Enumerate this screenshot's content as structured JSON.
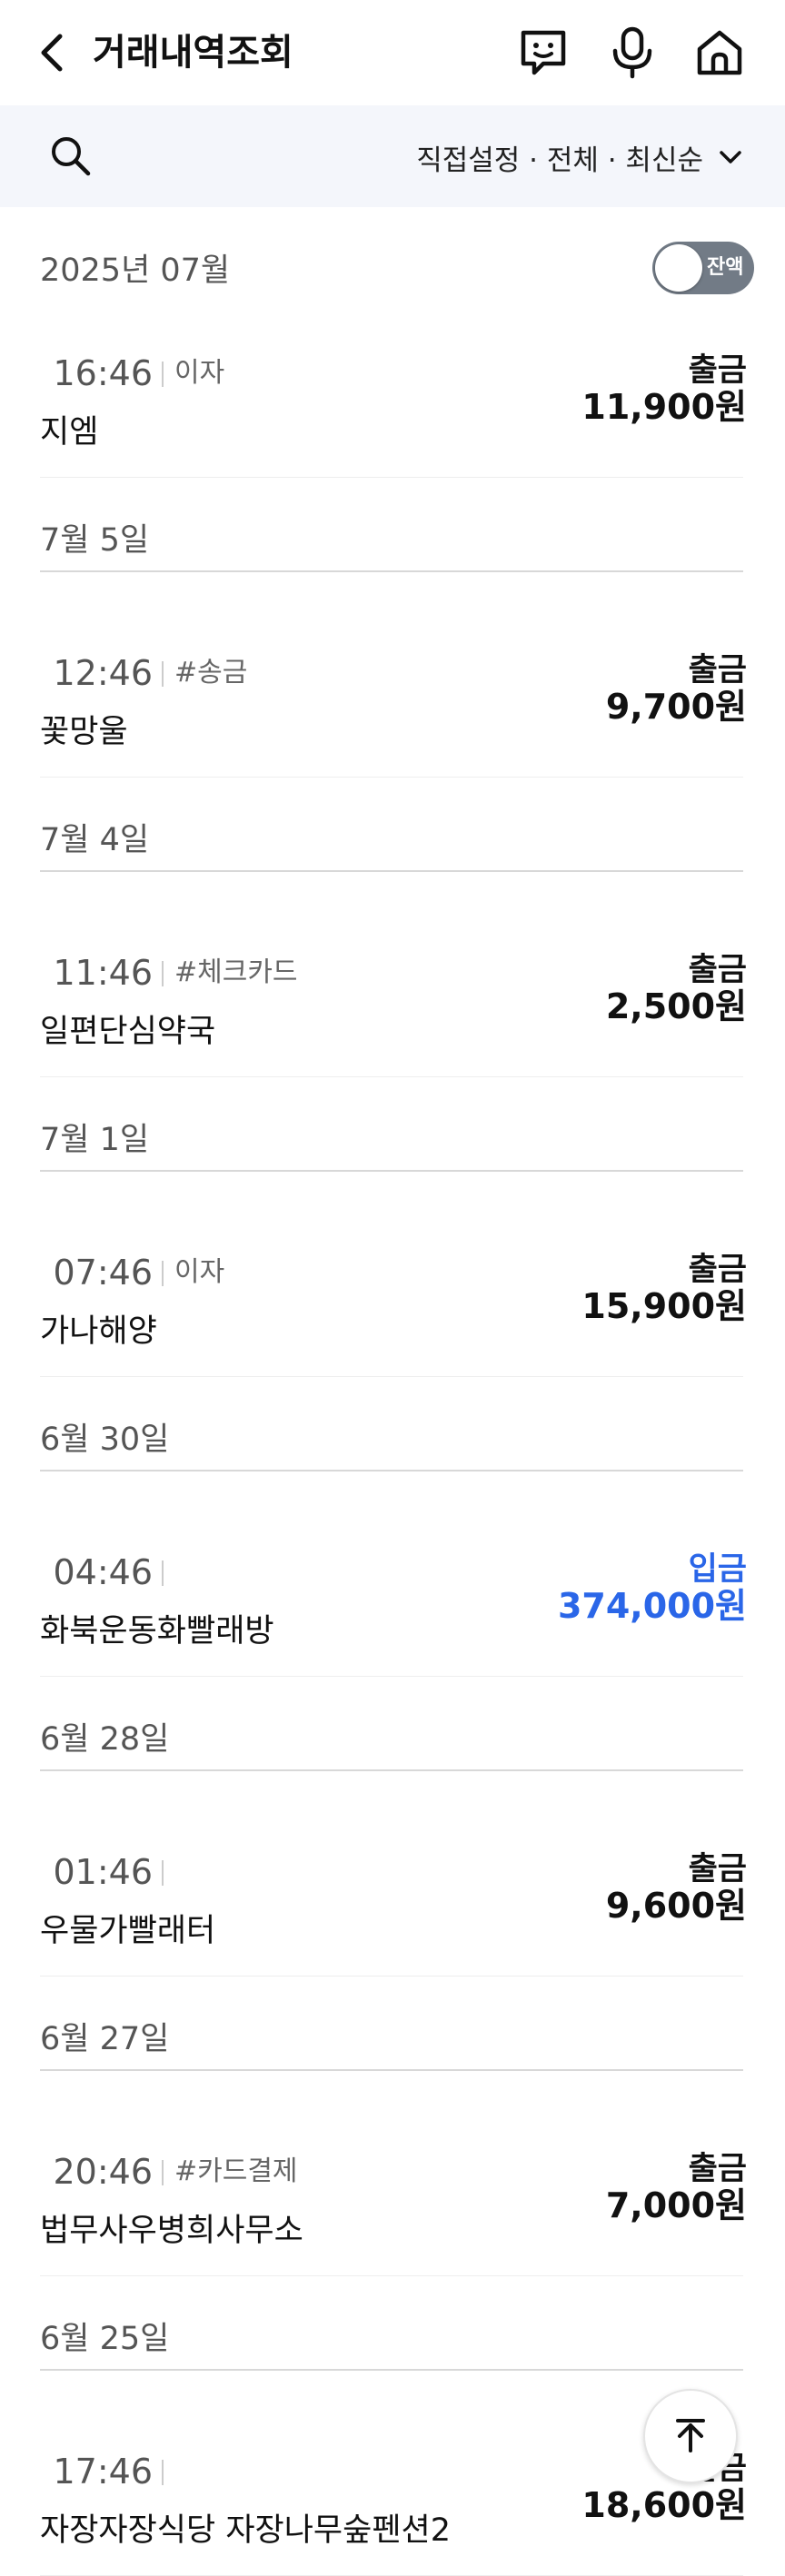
{
  "header": {
    "title": "거래내역조회",
    "back_icon": "chevron-left-icon",
    "icons": [
      "chat-icon",
      "mic-icon",
      "home-icon"
    ]
  },
  "filter": {
    "search_icon": "search-icon",
    "summary": "직접설정 · 전체 · 최신순",
    "dropdown_icon": "chevron-down-icon"
  },
  "month": {
    "label": "2025년 07월",
    "balance_toggle_label": "잔액",
    "balance_toggle_on": false
  },
  "colors": {
    "deposit": "#2a66e8",
    "withdrawal": "#111111",
    "filter_bg": "#f4f6fb",
    "toggle_bg": "#727b86"
  },
  "groups": [
    {
      "date": "",
      "items": [
        {
          "time": "16:46",
          "tag": "이자",
          "name": "지엠",
          "type": "출금",
          "amount": "11,900원"
        }
      ]
    },
    {
      "date": "7월 5일",
      "items": [
        {
          "time": "12:46",
          "tag": "#송금",
          "name": "꽃망울",
          "type": "출금",
          "amount": "9,700원"
        }
      ]
    },
    {
      "date": "7월 4일",
      "items": [
        {
          "time": "11:46",
          "tag": "#체크카드",
          "name": "일편단심약국",
          "type": "출금",
          "amount": "2,500원"
        }
      ]
    },
    {
      "date": "7월 1일",
      "items": [
        {
          "time": "07:46",
          "tag": "이자",
          "name": "가나해양",
          "type": "출금",
          "amount": "15,900원"
        }
      ]
    },
    {
      "date": "6월 30일",
      "items": [
        {
          "time": "04:46",
          "tag": "",
          "name": "화북운동화빨래방",
          "type": "입금",
          "amount": "374,000원"
        }
      ]
    },
    {
      "date": "6월 28일",
      "items": [
        {
          "time": "01:46",
          "tag": "",
          "name": "우물가빨래터",
          "type": "출금",
          "amount": "9,600원"
        }
      ]
    },
    {
      "date": "6월 27일",
      "items": [
        {
          "time": "20:46",
          "tag": "#카드결제",
          "name": "법무사우병희사무소",
          "type": "출금",
          "amount": "7,000원"
        }
      ]
    },
    {
      "date": "6월 25일",
      "items": [
        {
          "time": "17:46",
          "tag": "",
          "name": "자장자장식당 자장나무숲펜션2",
          "type": "출금",
          "amount": "18,600원"
        }
      ]
    }
  ],
  "scroll_top_icon": "arrow-up-icon"
}
